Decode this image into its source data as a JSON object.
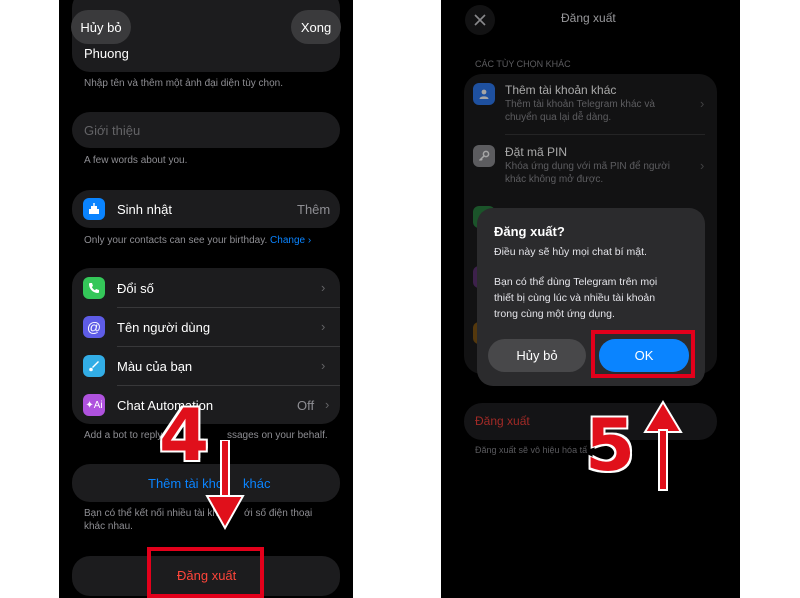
{
  "left": {
    "cancel": "Hủy bỏ",
    "done": "Xong",
    "name_value": "Phuong",
    "name_caption": "Nhập tên và thêm một ảnh đại diện tùy chọn.",
    "bio_placeholder": "Giới thiệu",
    "bio_caption": "A few words about you.",
    "birthday_label": "Sinh nhật",
    "birthday_value": "Thêm",
    "birthday_caption": "Only your contacts can see your birthday.",
    "birthday_change": "Change",
    "menu": [
      {
        "label": "Đổi số",
        "value": "",
        "icon": "phone-icon",
        "color": "#34c759"
      },
      {
        "label": "Tên người dùng",
        "value": "",
        "icon": "at-icon",
        "color": "#5e5ce6"
      },
      {
        "label": "Màu của bạn",
        "value": "",
        "icon": "brush-icon",
        "color": "#32ade6"
      },
      {
        "label": "Chat Automation",
        "value": "Off",
        "icon": "bot-icon",
        "color": "#af52de"
      }
    ],
    "automation_caption_start": "Add a bot to reply",
    "automation_caption_end": "ssages on your behalf.",
    "add_account": "Thêm tài kho",
    "add_account_end": "khác",
    "add_caption_line1": "Bạn có thể kết nối nhiều tài kho",
    "add_caption_line1_end": "ới số điện thoại",
    "add_caption_line2": "khác nhau.",
    "logout": "Đăng xuất",
    "step_number": "4"
  },
  "right": {
    "title": "Đăng xuất",
    "section_header": "CÁC TÙY CHỌN KHÁC",
    "options": [
      {
        "title": "Thêm tài khoản khác",
        "subtitle1": "Thêm tài khoản Telegram khác và",
        "subtitle2": "chuyển qua lại dễ dàng.",
        "icon": "person-icon",
        "color": "#2f7bf5"
      },
      {
        "title": "Đặt mã PIN",
        "subtitle1": "Khóa ứng dụng với mã PIN để người",
        "subtitle2": "khác không mở được.",
        "icon": "key-icon",
        "color": "#8e8e93"
      }
    ],
    "logout_row": "Đăng xuất",
    "logout_caption": "Đăng xuất sẽ vô hiệu hóa tấ",
    "dialog": {
      "title": "Đăng xuất?",
      "line1": "Điều này sẽ hủy mọi chat bí mật.",
      "body1": "Bạn có thể dùng Telegram trên mọi",
      "body2": "thiết bị cùng lúc và nhiều tài khoản",
      "body3": "trong cùng một ứng dụng.",
      "cancel": "Hủy bỏ",
      "ok": "OK"
    },
    "step_number": "5"
  },
  "colors": {
    "accent": "#0a84ff",
    "danger": "#ff453a",
    "annotation": "#e3001b"
  }
}
